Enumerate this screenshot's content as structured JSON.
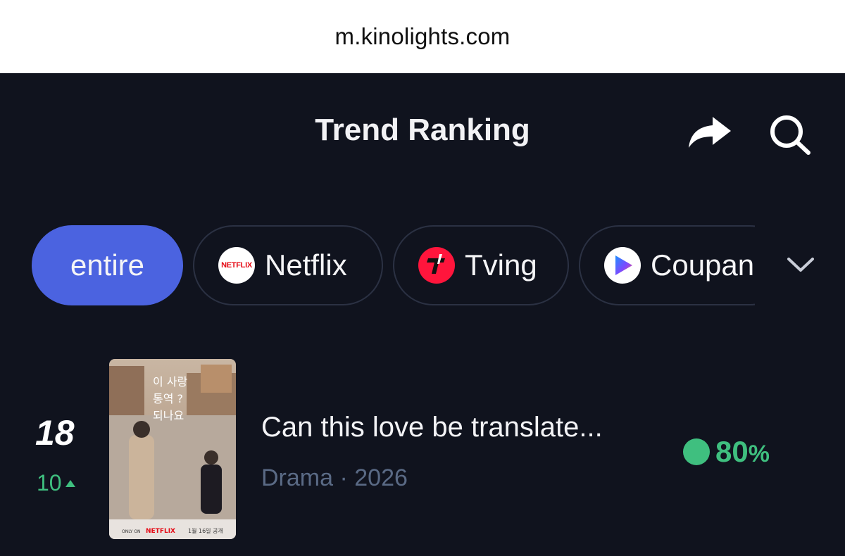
{
  "browser": {
    "url": "m.kinolights.com"
  },
  "header": {
    "title": "Trend Ranking",
    "share_icon": "share-arrow-icon",
    "search_icon": "search-icon"
  },
  "filters": {
    "items": [
      {
        "label": "entire",
        "active": true
      },
      {
        "label": "Netflix",
        "logo_text": "NETFLIX",
        "icon": "netflix-logo-icon"
      },
      {
        "label": "Tving",
        "icon": "tving-logo-icon"
      },
      {
        "label": "Coupang",
        "icon": "coupang-play-logo-icon"
      }
    ],
    "expand_icon": "chevron-down-icon"
  },
  "ranking": [
    {
      "rank": "18",
      "change": "10",
      "change_direction": "up",
      "title": "Can this love be translate...",
      "genre": "Drama",
      "separator": "·",
      "year": "2026",
      "score": "80",
      "score_unit": "%",
      "poster_text": {
        "line1": "이 사랑",
        "line2": "통역 ?",
        "line3": "되나요",
        "platform": "NETFLIX",
        "only_on": "ONLY ON",
        "release": "1월 16일 공개"
      }
    }
  ],
  "colors": {
    "background": "#10131e",
    "accent": "#4b63e0",
    "positive": "#3fbf7f",
    "meta": "#5a6a85",
    "chip_border": "#2b3143"
  }
}
